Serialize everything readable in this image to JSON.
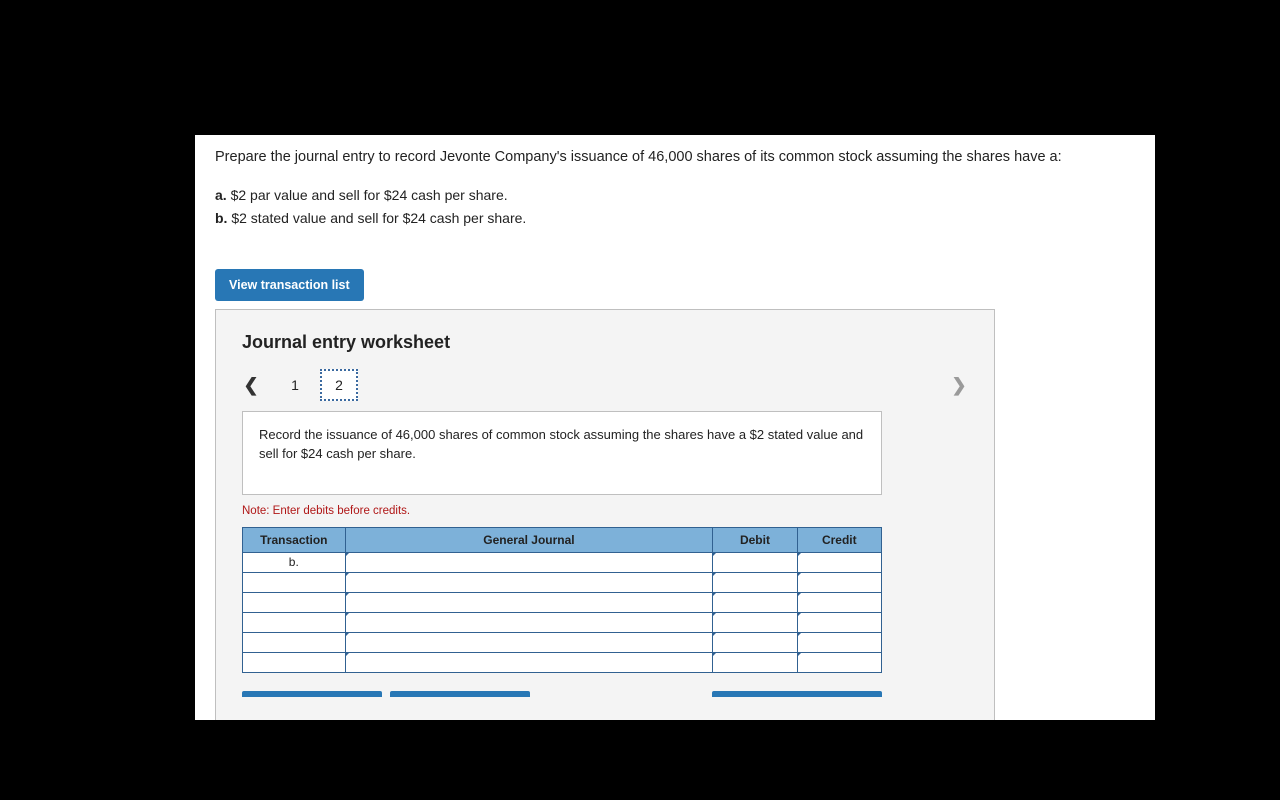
{
  "prompt": "Prepare the journal entry to record Jevonte Company's issuance of 46,000 shares of its common stock assuming the shares have a:",
  "subitems": [
    {
      "marker": "a.",
      "text": "$2 par value and sell for $24 cash per share."
    },
    {
      "marker": "b.",
      "text": "$2 stated value and sell for $24 cash per share."
    }
  ],
  "view_btn": "View transaction list",
  "worksheet": {
    "title": "Journal entry worksheet",
    "pages": [
      "1",
      "2"
    ],
    "active_page_index": 1,
    "instruction": "Record the issuance of 46,000 shares of common stock assuming the shares have a $2 stated value and sell for $24 cash per share.",
    "note": "Note: Enter debits before credits.",
    "columns": {
      "transaction": "Transaction",
      "general_journal": "General Journal",
      "debit": "Debit",
      "credit": "Credit"
    },
    "rows": [
      {
        "transaction": "b.",
        "gj": "",
        "debit": "",
        "credit": ""
      },
      {
        "transaction": "",
        "gj": "",
        "debit": "",
        "credit": ""
      },
      {
        "transaction": "",
        "gj": "",
        "debit": "",
        "credit": ""
      },
      {
        "transaction": "",
        "gj": "",
        "debit": "",
        "credit": ""
      },
      {
        "transaction": "",
        "gj": "",
        "debit": "",
        "credit": ""
      },
      {
        "transaction": "",
        "gj": "",
        "debit": "",
        "credit": ""
      }
    ]
  }
}
